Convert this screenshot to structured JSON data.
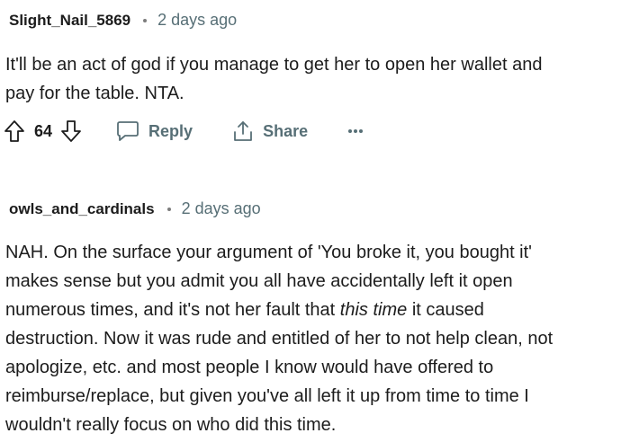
{
  "comments": [
    {
      "author": "Slight_Nail_5869",
      "time": "2 days ago",
      "body_lines": [
        "It'll be an act of god if you manage to get her to open her wallet and",
        "pay for the table. NTA."
      ],
      "score": "64",
      "reply_label": "Reply",
      "share_label": "Share",
      "more_label": "•••"
    },
    {
      "author": "owls_and_cardinals",
      "time": "2 days ago",
      "body_segments": [
        "NAH. On the surface your argument of 'You broke it, you bought it'\nmakes sense but you admit you all have accidentally left it open\nnumerous times, and it's not her fault that ",
        "this time",
        " it caused\ndestruction. Now it was rude and entitled of her to not help clean, not\napologize, etc. and most people I know would have offered to\nreimburse/replace, but given you've all left it up from time to time I\nwouldn't really focus on who did this time."
      ]
    }
  ],
  "icons": [
    "upvote-icon",
    "downvote-icon",
    "comment-bubble-icon",
    "share-icon",
    "more-options-icon"
  ],
  "colors": {
    "text": "#1c1c1c",
    "meta": "#576f76",
    "dot": "#7c7c7c",
    "background": "#ffffff"
  }
}
